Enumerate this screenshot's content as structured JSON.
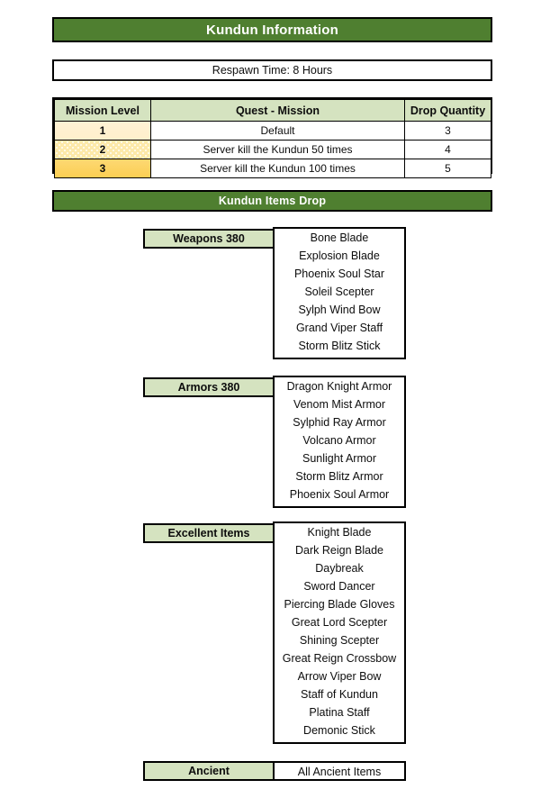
{
  "header": {
    "title": "Kundun Information",
    "respawn": "Respawn Time: 8 Hours",
    "items_drop_title": "Kundun Items Drop"
  },
  "colors": {
    "dark_green": "#4F7F30",
    "light_green": "#D5E3C0",
    "border": "#000000",
    "level1_fill": "#FFF2D4",
    "level2_fill": "#FDE9A9",
    "level3_fill": "#FCCE52",
    "white": "#FFFFFF"
  },
  "mission_table": {
    "columns": [
      "Mission Level",
      "Quest - Mission",
      "Drop Quantity"
    ],
    "rows": [
      {
        "level": "1",
        "quest": "Default",
        "drop": "3"
      },
      {
        "level": "2",
        "quest": "Server kill the Kundun 50 times",
        "drop": "4"
      },
      {
        "level": "3",
        "quest": "Server kill the Kundun 100 times",
        "drop": "5"
      }
    ]
  },
  "categories": [
    {
      "label": "Weapons 380",
      "items": [
        "Bone Blade",
        "Explosion Blade",
        "Phoenix Soul Star",
        "Soleil Scepter",
        "Sylph Wind Bow",
        "Grand Viper Staff",
        "Storm Blitz Stick"
      ]
    },
    {
      "label": "Armors 380",
      "items": [
        "Dragon Knight Armor",
        "Venom Mist Armor",
        "Sylphid Ray Armor",
        "Volcano Armor",
        "Sunlight Armor",
        "Storm Blitz Armor",
        "Phoenix Soul Armor"
      ]
    },
    {
      "label": "Excellent Items",
      "items": [
        "Knight Blade",
        "Dark Reign Blade",
        "Daybreak",
        "Sword Dancer",
        "Piercing Blade Gloves",
        "Great Lord Scepter",
        "Shining Scepter",
        "Great Reign Crossbow",
        "Arrow Viper Bow",
        "Staff of Kundun",
        "Platina Staff",
        "Demonic Stick"
      ]
    },
    {
      "label": "Ancient",
      "items": [
        "All Ancient Items"
      ]
    }
  ]
}
